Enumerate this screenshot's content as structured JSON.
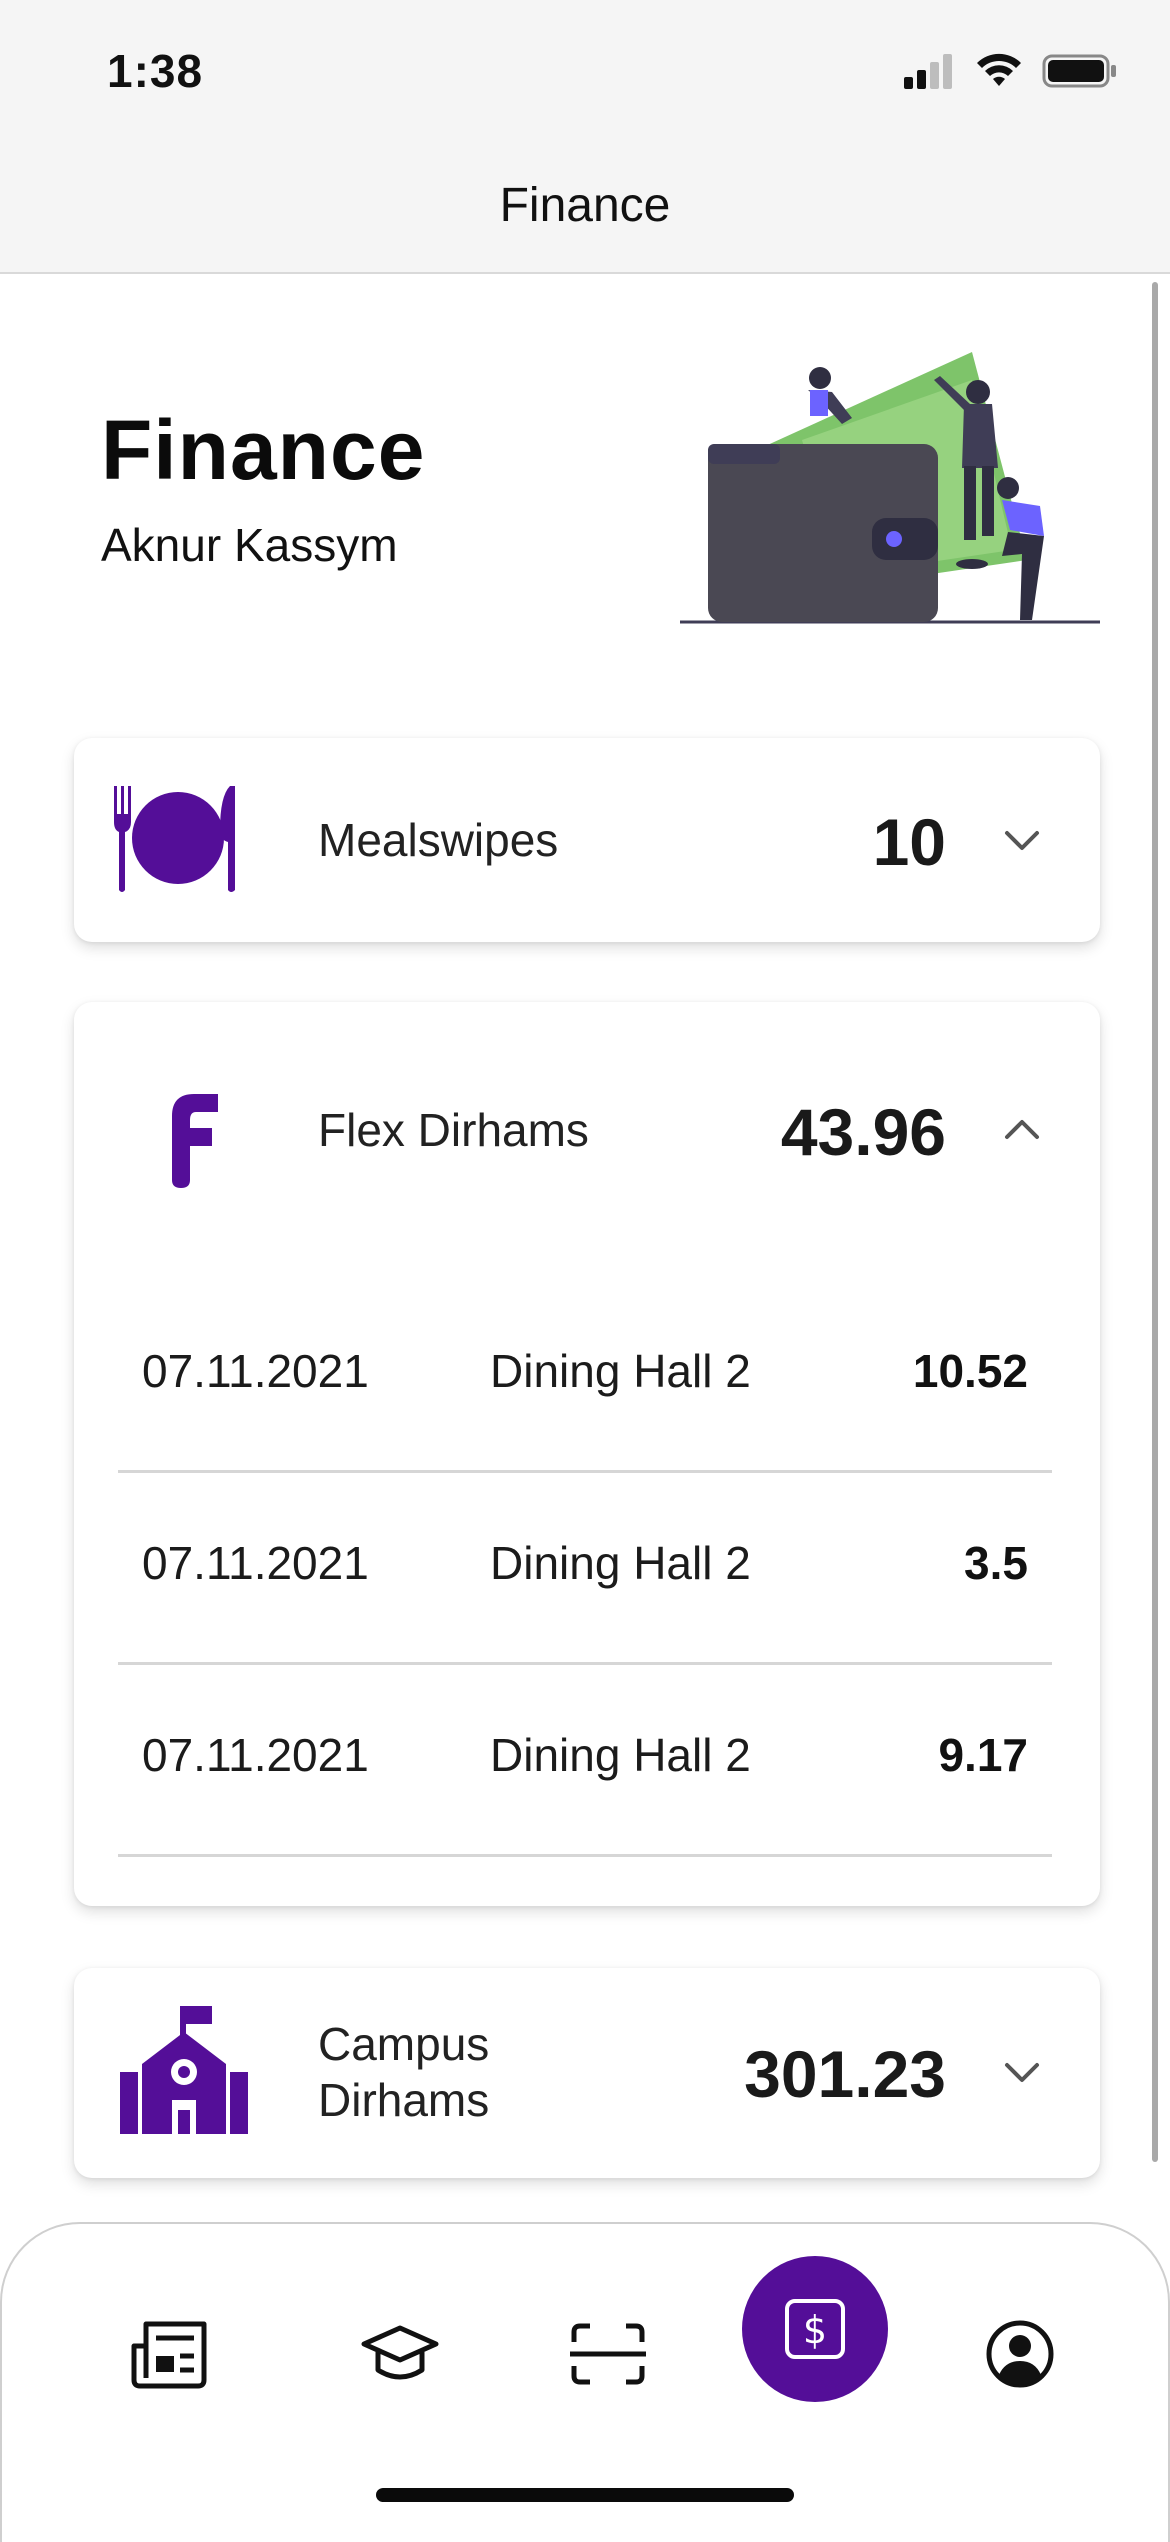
{
  "status_bar": {
    "time": "1:38"
  },
  "nav": {
    "title": "Finance"
  },
  "header": {
    "title": "Finance",
    "user_name": "Aknur Kassym"
  },
  "accounts": [
    {
      "label": "Mealswipes",
      "amount": "10",
      "expanded": false,
      "icon": "plate-cutlery-icon"
    },
    {
      "label": "Flex Dirhams",
      "amount": "43.96",
      "expanded": true,
      "icon": "letter-f-icon",
      "transactions": [
        {
          "date": "07.11.2021",
          "place": "Dining Hall 2",
          "amount": "10.52"
        },
        {
          "date": "07.11.2021",
          "place": "Dining Hall 2",
          "amount": "3.5"
        },
        {
          "date": "07.11.2021",
          "place": "Dining Hall 2",
          "amount": "9.17"
        }
      ]
    },
    {
      "label_line1": "Campus",
      "label_line2": "Dirhams",
      "amount": "301.23",
      "expanded": false,
      "icon": "school-building-icon"
    }
  ],
  "tab_bar": {
    "tabs": [
      "news-icon",
      "graduation-cap-icon",
      "scan-icon",
      "dollar-icon",
      "profile-icon"
    ],
    "active": "dollar-icon"
  },
  "colors": {
    "accent": "#540e98",
    "money_green": "#7ec46a",
    "wallet": "#4a4853"
  }
}
